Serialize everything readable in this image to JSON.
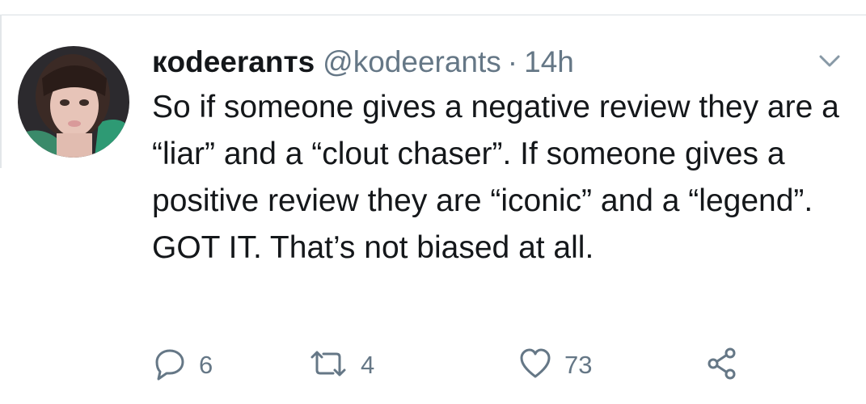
{
  "tweet": {
    "author": {
      "display_name": "кodeeranтs",
      "handle": "@kodeerants",
      "avatar_icon": "profile-photo"
    },
    "separator": "·",
    "timestamp": "14h",
    "menu_icon": "chevron-down-icon",
    "text": "So if someone gives a negative review they are a “liar” and a “clout chaser”. If someone gives a positive review they are “iconic” and a “legend”. GOT IT. That’s not biased at all.",
    "actions": {
      "reply": {
        "icon": "reply-icon",
        "count": "6"
      },
      "retweet": {
        "icon": "retweet-icon",
        "count": "4"
      },
      "like": {
        "icon": "heart-icon",
        "count": "73"
      },
      "share": {
        "icon": "share-icon"
      }
    }
  },
  "colors": {
    "text": "#14171a",
    "secondary": "#657786",
    "divider": "#d9dfe3"
  }
}
